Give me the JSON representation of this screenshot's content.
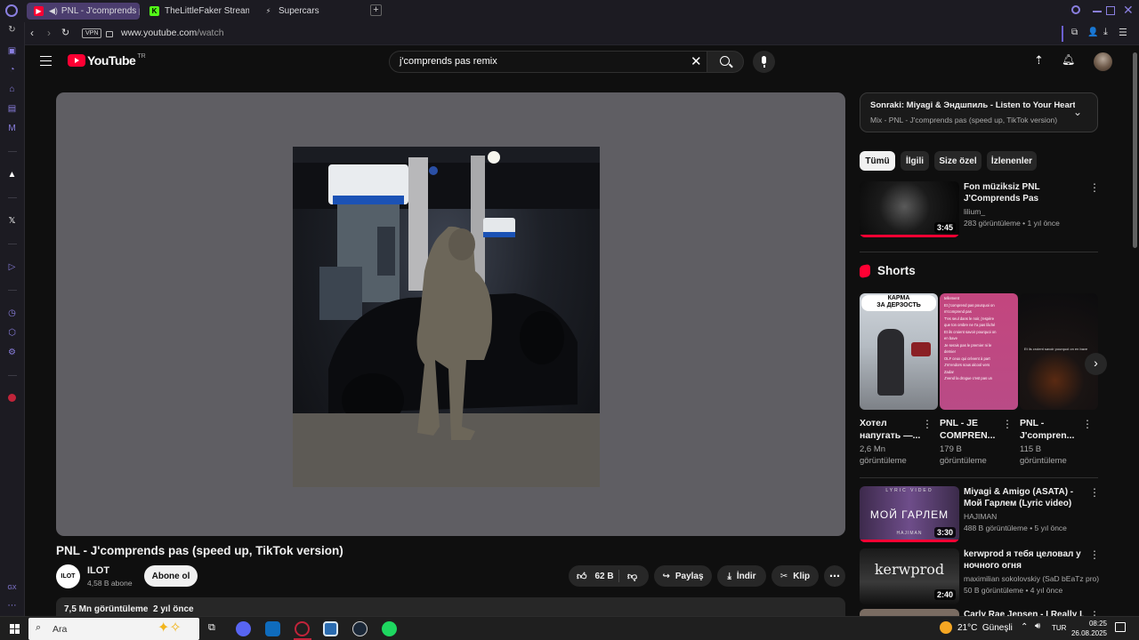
{
  "browser": {
    "tabs": [
      {
        "title": "PNL - J'comprends pas",
        "active": true
      },
      {
        "title": "TheLittleFaker Stream - V",
        "active": false
      },
      {
        "title": "Supercars",
        "active": false
      }
    ],
    "vpn_label": "VPN",
    "url_host": "www.youtube.com",
    "url_path": "/watch"
  },
  "youtube": {
    "logo_text": "YouTube",
    "region": "TR",
    "search_value": "j'comprends pas remix",
    "video": {
      "title": "PNL - J'comprends pas (speed up, TikTok version)",
      "channel": "ILOT",
      "channel_avatar_text": "ILOT",
      "subscribers": "4,58 B abone",
      "subscribe_label": "Abone ol",
      "likes": "62 B",
      "share_label": "Paylaş",
      "download_label": "İndir",
      "clip_label": "Klip",
      "views_line": "7,5 Mn görüntüleme  2 yıl önce"
    },
    "up_next": {
      "prefix": "Sonraki:",
      "title": "Miyagi & Эндшпиль - Listen to Your Heart ...",
      "subtitle": "Mix - PNL - J'comprends pas (speed up, TikTok version)"
    },
    "chips": [
      "Tümü",
      "İlgili",
      "Size özel",
      "İzlenenler"
    ],
    "shorts_heading": "Shorts",
    "recommendations": [
      {
        "title": "Fon müziksiz PNL J'Comprends Pas",
        "channel": "lilium_",
        "meta": "283 görüntüleme • 1 yıl önce",
        "duration": "3:45"
      },
      {
        "title": "Miyagi & Amigo (ASATA) - Мой Гарлем (Lyric video)",
        "channel": "HAJIMAN",
        "meta": "488 B görüntüleme • 5 yıl önce",
        "duration": "3:30"
      },
      {
        "title": "kerwprod   я тебя целовал у ночного огня",
        "channel": "maximilian sokolovskiy (SaD bEaTz pro)",
        "meta": "50 B görüntüleme • 4 yıl önce",
        "duration": "2:40"
      },
      {
        "title": "Carly Rae Jepsen - I Really Like",
        "channel": "",
        "meta": "",
        "duration": ""
      }
    ],
    "shorts": [
      {
        "title1": "Хотел",
        "title2": "напугать —...",
        "views": "2,6 Mn",
        "views2": "görüntüleme",
        "thumb_text1": "КАРМА",
        "thumb_text2": "ЗА ДЕРЗОСТЬ"
      },
      {
        "title1": "PNL - JE",
        "title2": "COMPREN...",
        "views": "179 B",
        "views2": "görüntüleme",
        "lyrics": [
          "tellement",
          "Et j'comprend pas pourquoi on",
          "m'comprend pas",
          "T'es seul dans le noir, j'espère",
          "que ton ombre ne t'a pas lâché",
          "Et ils croient savoir pourquoi on",
          "en bave",
          "Je serais pas le premier ni le",
          "dernier",
          "OLF ceux qui crèvent à part",
          "J'm'endors sous alcool vers",
          "Zadar",
          "J'vend la drogue c'est pas un"
        ]
      },
      {
        "title1": "PNL -",
        "title2": "J'compren...",
        "views": "115 B",
        "views2": "görüntüleme",
        "thumb_text1": "Et ils croient savoir pourquoi on en bave"
      }
    ],
    "mix_thumb_text": "МОЙ ГАРЛЕМ",
    "mix_thumb_top": "LYRIC VIDEO",
    "mix_thumb_bottom": "HAJIMAN",
    "kerw_thumb_text": "kerwprod"
  },
  "taskbar": {
    "search_placeholder": "Ara",
    "weather": "21°C  Güneşli",
    "lang": "TUR",
    "time": "08:25",
    "date": "26.08.2025"
  },
  "colors": {
    "accent_purple": "#8a7fe0",
    "youtube_red": "#ff0033",
    "progress_red": "#ff0033"
  }
}
